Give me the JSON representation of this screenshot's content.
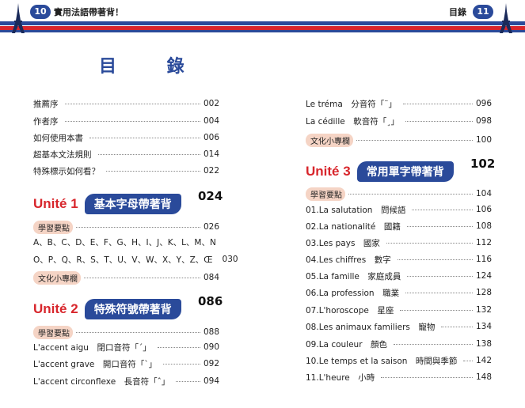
{
  "header": {
    "left_page": "10",
    "left_title": "實用法語帶著背！",
    "right_title": "目錄",
    "right_page": "11"
  },
  "main_title": "目 錄",
  "left_items": [
    {
      "label": "推薦序",
      "page": "002"
    },
    {
      "label": "作者序",
      "page": "004"
    },
    {
      "label": "如何使用本書",
      "page": "006"
    },
    {
      "label": "超基本文法規則",
      "page": "014"
    },
    {
      "label": "特殊標示如何看？",
      "page": "022"
    }
  ],
  "unit1": {
    "fr": "Unité 1",
    "zh": "基本字母帶著背",
    "page": "024"
  },
  "unit1_items": [
    {
      "label": "學習要點",
      "page": "026",
      "pill": true
    },
    {
      "label": "A、B、C、D、E、F、G、H、I、J、K、L、M、N",
      "page": "",
      "pill": false
    },
    {
      "label": "O、P、Q、R、S、T、U、V、W、X、Y、Z、Œ",
      "page": "030",
      "pill": false
    },
    {
      "label": "文化小專欄",
      "page": "084",
      "pill": true
    }
  ],
  "unit2": {
    "fr": "Unité 2",
    "zh": "特殊符號帶著背",
    "page": "086"
  },
  "unit2_items": [
    {
      "label": "學習要點",
      "page": "088",
      "pill": true
    },
    {
      "label": "L'accent aigu　閉口音符「ˊ」",
      "page": "090",
      "pill": false
    },
    {
      "label": "L'accent grave　開口音符「ˋ」",
      "page": "092",
      "pill": false
    },
    {
      "label": "L'accent circonflexe　長音符「ˆ」",
      "page": "094",
      "pill": false
    }
  ],
  "right_items": [
    {
      "label": "Le tréma　分音符「¨」",
      "page": "096",
      "pill": false
    },
    {
      "label": "La cédille　軟音符「¸」",
      "page": "098",
      "pill": false
    },
    {
      "label": "文化小專欄",
      "page": "100",
      "pill": true
    }
  ],
  "unit3": {
    "fr": "Unité 3",
    "zh": "常用單字帶著背",
    "page": "102"
  },
  "unit3_items": [
    {
      "label": "學習要點",
      "page": "104",
      "pill": true
    },
    {
      "label": "01.La salutation　問候語",
      "page": "106",
      "pill": false
    },
    {
      "label": "02.La nationalité　國籍",
      "page": "108",
      "pill": false
    },
    {
      "label": "03.Les pays　國家",
      "page": "112",
      "pill": false
    },
    {
      "label": "04.Les chiffres　數字",
      "page": "116",
      "pill": false
    },
    {
      "label": "05.La famille　家庭成員",
      "page": "124",
      "pill": false
    },
    {
      "label": "06.La profession　職業",
      "page": "128",
      "pill": false
    },
    {
      "label": "07.L'horoscope　星座",
      "page": "132",
      "pill": false
    },
    {
      "label": "08.Les animaux familiers　寵物",
      "page": "134",
      "pill": false
    },
    {
      "label": "09.La couleur　顏色",
      "page": "138",
      "pill": false
    },
    {
      "label": "10.Le temps et la saison　時間與季節",
      "page": "142",
      "pill": false
    },
    {
      "label": "11.L'heure　小時",
      "page": "148",
      "pill": false
    }
  ],
  "colors": {
    "blue": "#2a4a9a",
    "red": "#d8262c",
    "pill": "#f5d4c5"
  },
  "icons": [
    "eiffel-tower-icon",
    "flower-icon"
  ]
}
